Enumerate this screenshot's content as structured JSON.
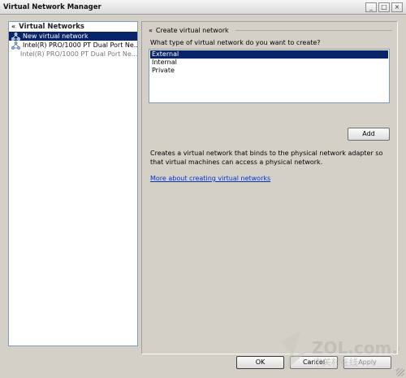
{
  "window": {
    "title": "Virtual Network Manager",
    "buttons": [
      "_",
      "□",
      "×"
    ]
  },
  "sidebar": {
    "header": "Virtual Networks",
    "collapse_glyph": "«",
    "items": [
      {
        "label": "New virtual network",
        "selected": true
      },
      {
        "label": "Intel(R) PRO/1000 PT Dual Port Ne..."
      },
      {
        "label": "Intel(R) PRO/1000 PT Dual Port Ne..."
      }
    ]
  },
  "main": {
    "section_title": "Create virtual network",
    "question": "What type of virtual network do you want to create?",
    "options": [
      "External",
      "Internal",
      "Private"
    ],
    "selected_option": "External",
    "add_label": "Add",
    "description": "Creates a virtual network that binds to the physical network adapter so that virtual machines can access a physical network.",
    "more_link": "More about creating virtual networks"
  },
  "footer": {
    "ok": "OK",
    "cancel": "Cancel",
    "apply": "Apply"
  },
  "watermark": {
    "site": "ZOL.com.cn",
    "tagline": "中关村在线"
  },
  "colors": {
    "selection": "#0a246a",
    "link": "#0033cc",
    "dialog_bg": "#d4d0c8"
  }
}
